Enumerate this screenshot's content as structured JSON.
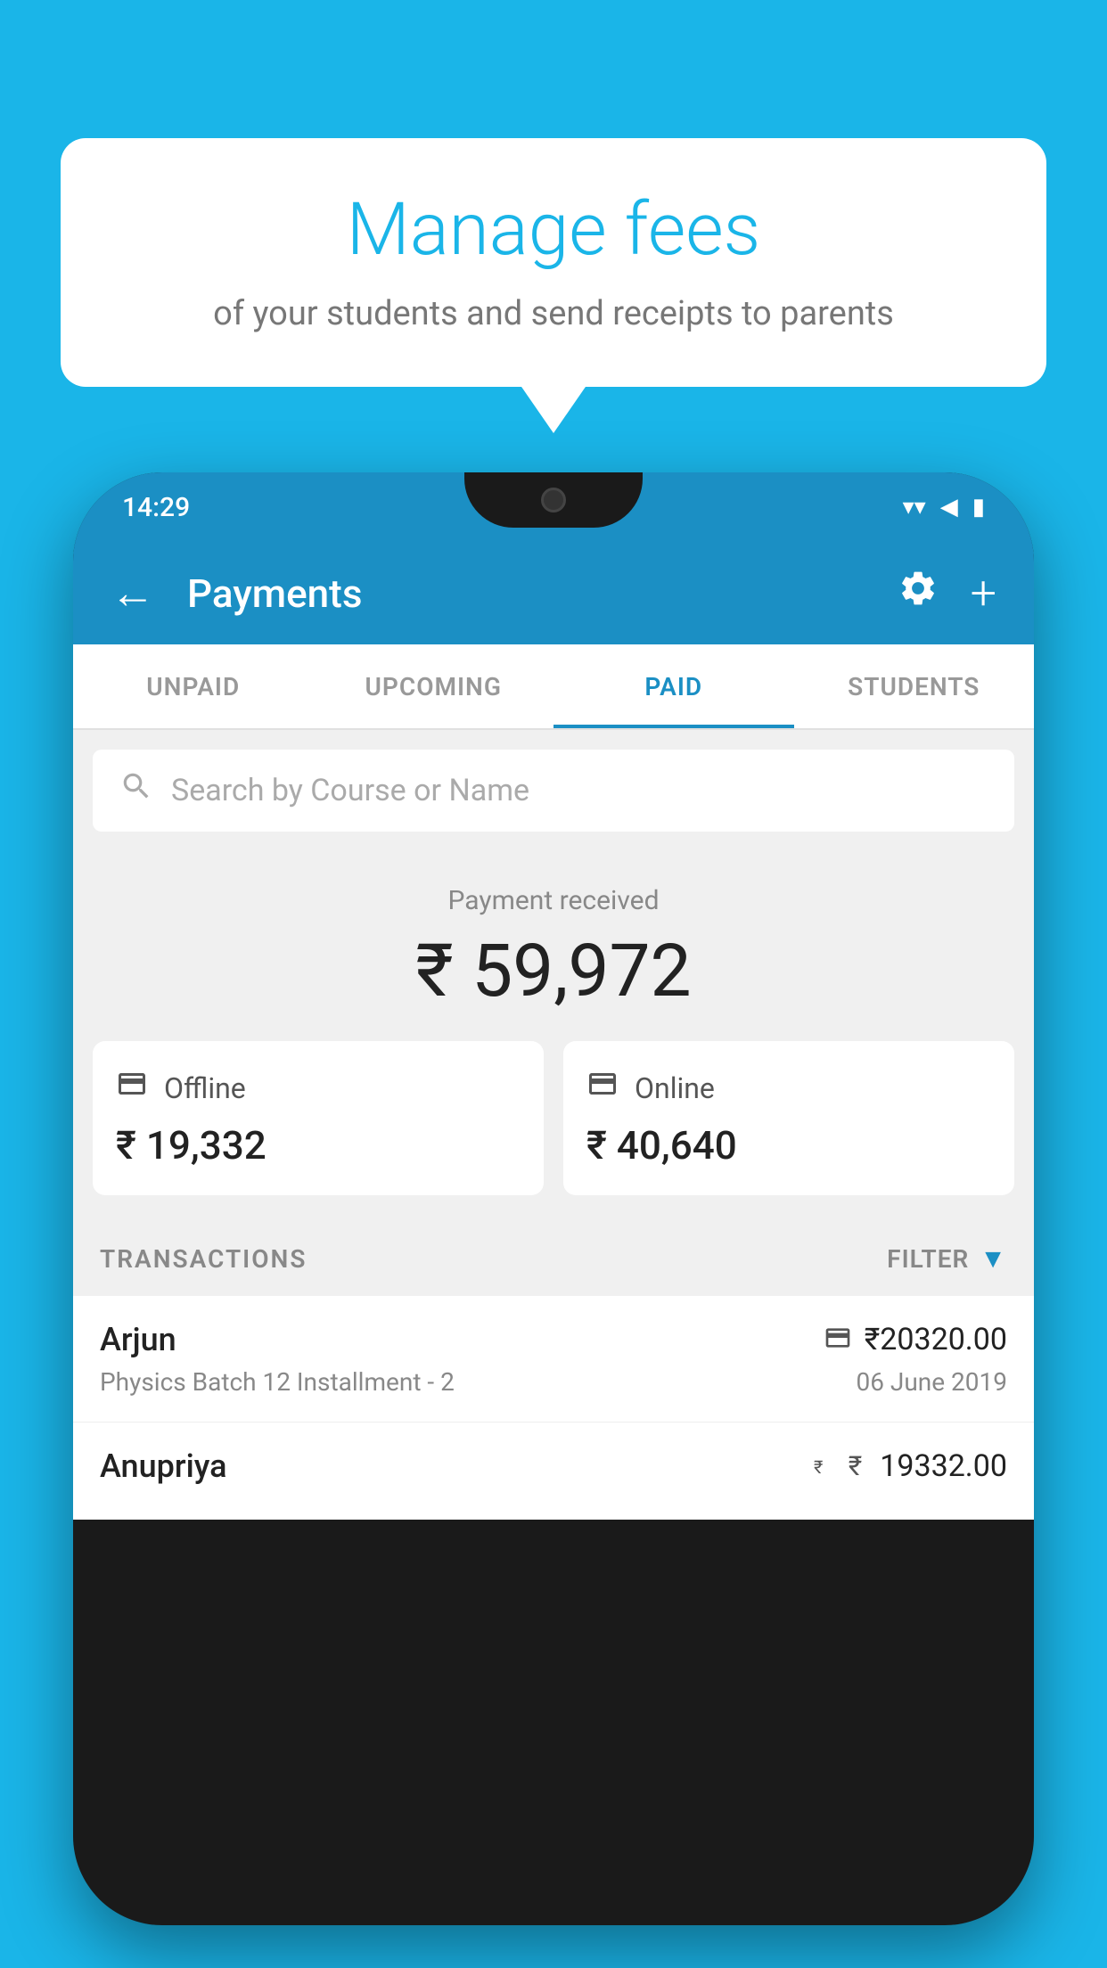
{
  "background_color": "#1ab5e8",
  "speech_bubble": {
    "title": "Manage fees",
    "subtitle": "of your students and send receipts to parents"
  },
  "phone": {
    "status_bar": {
      "time": "14:29",
      "wifi": "wifi",
      "signal": "signal",
      "battery": "battery"
    },
    "app_bar": {
      "title": "Payments",
      "back_label": "←",
      "settings_icon": "gear",
      "add_icon": "+"
    },
    "tabs": [
      {
        "label": "UNPAID",
        "active": false
      },
      {
        "label": "UPCOMING",
        "active": false
      },
      {
        "label": "PAID",
        "active": true
      },
      {
        "label": "STUDENTS",
        "active": false
      }
    ],
    "search": {
      "placeholder": "Search by Course or Name"
    },
    "payment_summary": {
      "label": "Payment received",
      "total": "₹ 59,972",
      "offline_label": "Offline",
      "offline_amount": "₹ 19,332",
      "online_label": "Online",
      "online_amount": "₹ 40,640"
    },
    "transactions": {
      "header_label": "TRANSACTIONS",
      "filter_label": "FILTER",
      "items": [
        {
          "name": "Arjun",
          "description": "Physics Batch 12 Installment - 2",
          "amount": "₹20320.00",
          "date": "06 June 2019",
          "payment_type": "card"
        },
        {
          "name": "Anupriya",
          "description": "",
          "amount": "₹19332.00",
          "date": "",
          "payment_type": "cash"
        }
      ]
    }
  }
}
